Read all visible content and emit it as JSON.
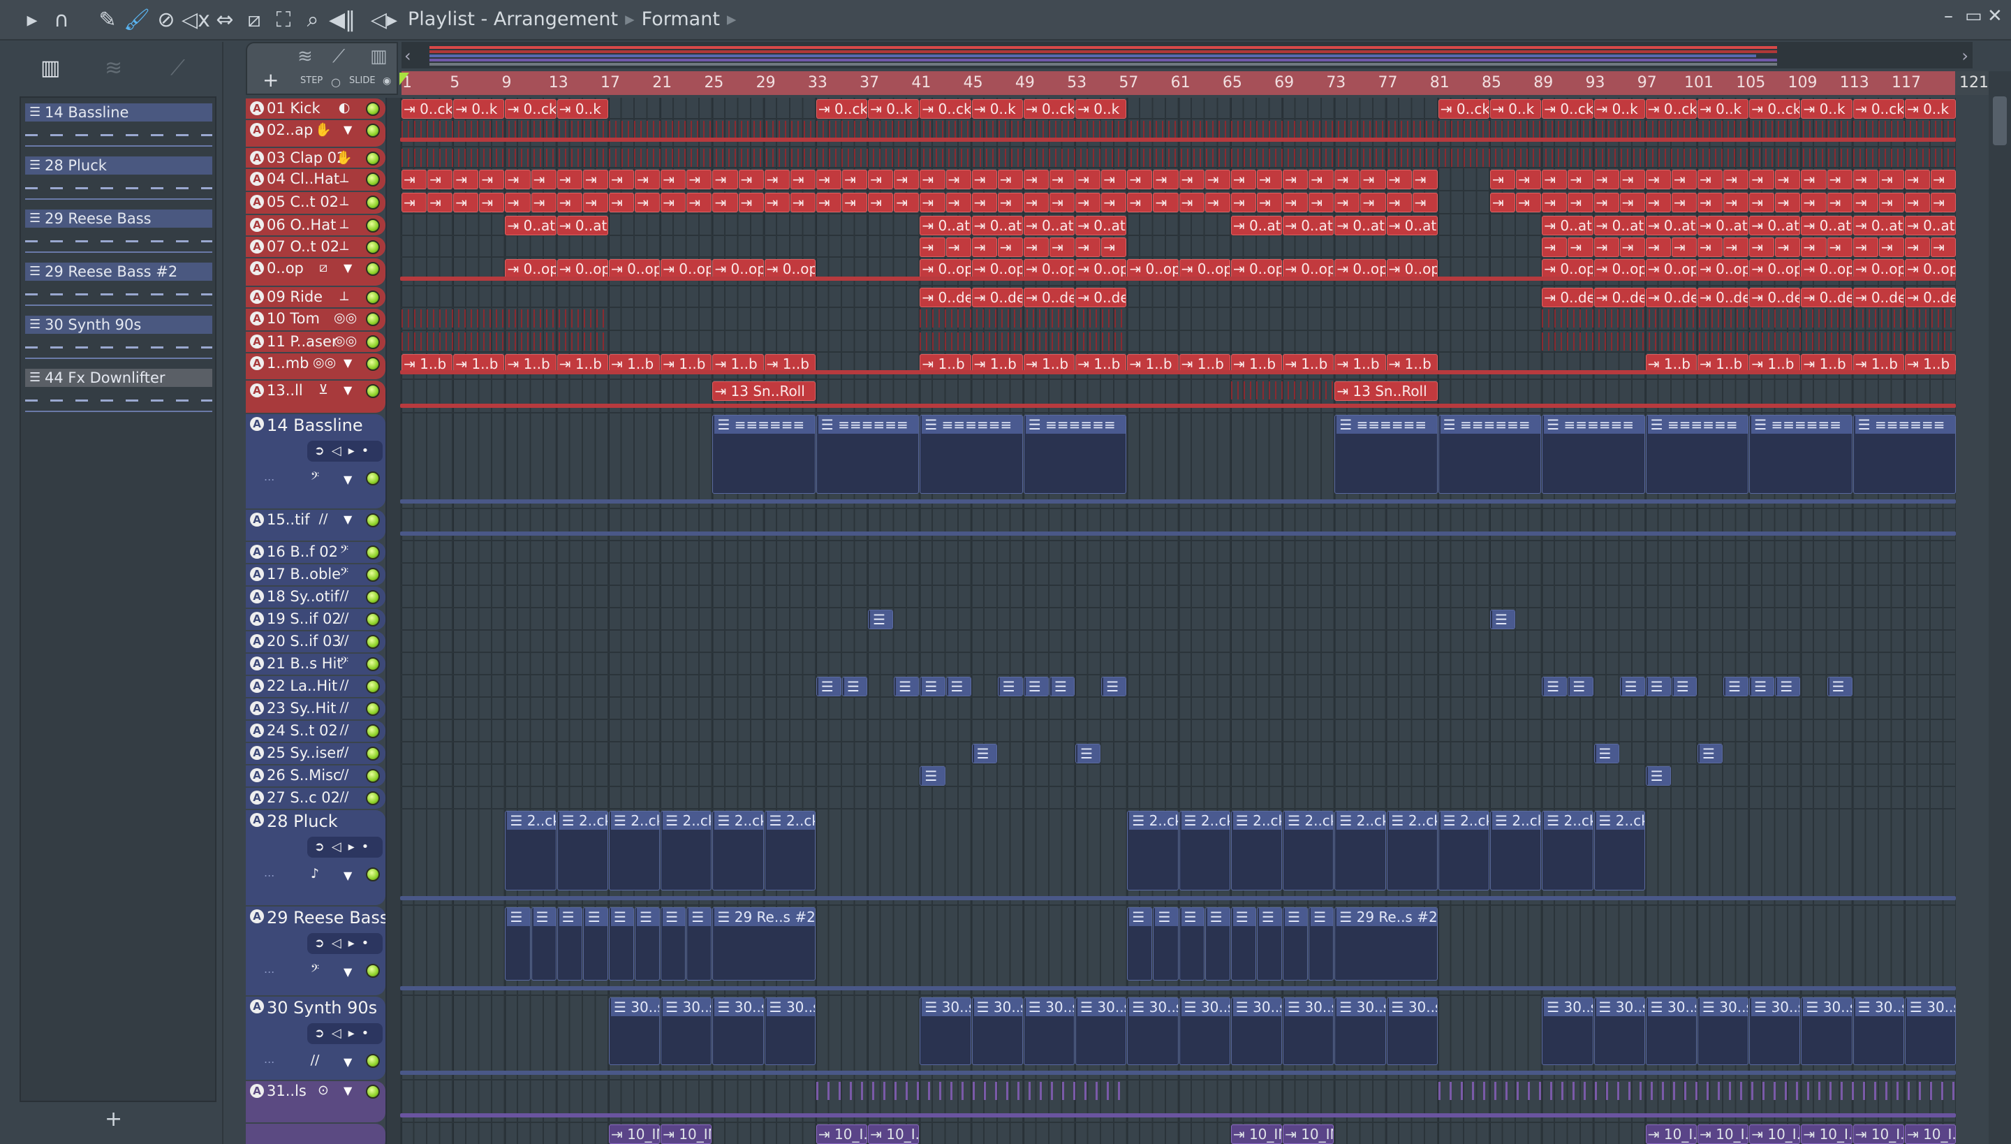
{
  "toolbar": {
    "icons": [
      "play-arrow",
      "magnet",
      "pencil",
      "brush",
      "mute",
      "mute-x",
      "slip",
      "slice",
      "select",
      "zoom",
      "playback"
    ],
    "title": "Playlist - Arrangement",
    "breadcrumb": "Formant"
  },
  "corner": {
    "step_label": "STEP",
    "slide_label": "SLIDE",
    "add": "+"
  },
  "picker": {
    "items": [
      {
        "label": "14 Bassline",
        "kind": "pattern"
      },
      {
        "label": "28 Pluck",
        "kind": "pattern"
      },
      {
        "label": "29 Reese Bass",
        "kind": "pattern"
      },
      {
        "label": "29 Reese Bass #2",
        "kind": "pattern"
      },
      {
        "label": "30 Synth 90s",
        "kind": "pattern"
      },
      {
        "label": "44 Fx Downlifter",
        "kind": "pattern"
      }
    ],
    "add": "+"
  },
  "ruler": {
    "bars": [
      1,
      5,
      9,
      13,
      17,
      21,
      25,
      29,
      33,
      37,
      41,
      45,
      49,
      53,
      57,
      61,
      65,
      69,
      73,
      77,
      81,
      85,
      89,
      93,
      97,
      101,
      105,
      109,
      113,
      117
    ],
    "end": "121"
  },
  "colors": {
    "red": "#a83a3c",
    "blue": "#3d4978",
    "purple": "#5b4a82",
    "clip_red": "#c23a3e",
    "led": "#8fd22a"
  },
  "tracks": [
    {
      "name": "01 Kick",
      "group": "red",
      "icon": "kick-drum",
      "runs": [
        [
          1,
          17,
          4,
          [
            "0..ck",
            "0..k"
          ]
        ],
        [
          33,
          41,
          4,
          [
            "0..ck",
            "0..k"
          ]
        ],
        [
          41,
          57,
          4,
          [
            "0..ck",
            "0..k"
          ]
        ],
        [
          81,
          121,
          4,
          [
            "0..ck",
            "0..k"
          ]
        ]
      ]
    },
    {
      "name": "02..ap",
      "group": "red",
      "icon": "clap",
      "drop": true,
      "ticks": [
        [
          1,
          121
        ]
      ]
    },
    {
      "name": "03 Clap 02",
      "group": "red",
      "icon": "clap",
      "ticks": [
        [
          1,
          121
        ]
      ]
    },
    {
      "name": "04 Cl..Hat",
      "group": "red",
      "icon": "hihat",
      "runs": [
        [
          1,
          33,
          2,
          [
            ""
          ]
        ],
        [
          33,
          41,
          2,
          [
            ""
          ]
        ],
        [
          41,
          81,
          2,
          [
            ""
          ]
        ],
        [
          85,
          89,
          2,
          [
            ""
          ]
        ],
        [
          89,
          121,
          2,
          [
            ""
          ]
        ]
      ]
    },
    {
      "name": "05 C..t 02",
      "group": "red",
      "icon": "hihat",
      "runs": [
        [
          1,
          33,
          2,
          [
            ""
          ]
        ],
        [
          33,
          41,
          2,
          [
            ""
          ]
        ],
        [
          41,
          81,
          2,
          [
            ""
          ]
        ],
        [
          85,
          89,
          2,
          [
            ""
          ]
        ],
        [
          89,
          121,
          2,
          [
            ""
          ]
        ]
      ]
    },
    {
      "name": "06 O..Hat",
      "group": "red",
      "icon": "hihat",
      "runs": [
        [
          9,
          17,
          4,
          [
            "0..at"
          ]
        ],
        [
          41,
          57,
          4,
          [
            "0..at"
          ]
        ],
        [
          65,
          81,
          4,
          [
            "0..at"
          ]
        ],
        [
          89,
          121,
          4,
          [
            "0..at"
          ]
        ]
      ]
    },
    {
      "name": "07 O..t 02",
      "group": "red",
      "icon": "hihat",
      "runs": [
        [
          41,
          57,
          2,
          [
            ""
          ]
        ],
        [
          89,
          121,
          2,
          [
            ""
          ]
        ]
      ]
    },
    {
      "name": "0..op",
      "group": "red",
      "icon": "sampler",
      "drop": true,
      "runs": [
        [
          9,
          33,
          4,
          [
            "0..op"
          ]
        ],
        [
          41,
          81,
          4,
          [
            "0..op"
          ]
        ],
        [
          89,
          121,
          4,
          [
            "0..op"
          ]
        ]
      ]
    },
    {
      "name": "09 Ride",
      "group": "red",
      "icon": "hihat",
      "runs": [
        [
          41,
          57,
          4,
          [
            "0..de"
          ]
        ],
        [
          89,
          121,
          4,
          [
            "0..de"
          ]
        ]
      ]
    },
    {
      "name": "10 Tom",
      "group": "red",
      "icon": "toms",
      "ticks": [
        [
          1,
          17
        ],
        [
          41,
          57
        ],
        [
          89,
          121
        ]
      ]
    },
    {
      "name": "11 P..aser",
      "group": "red",
      "icon": "toms",
      "ticks": [
        [
          1,
          17
        ],
        [
          41,
          57
        ],
        [
          89,
          121
        ]
      ]
    },
    {
      "name": "1..mb",
      "group": "red",
      "icon": "toms",
      "drop": true,
      "runs": [
        [
          1,
          33,
          4,
          [
            "1..b"
          ]
        ],
        [
          41,
          81,
          4,
          [
            "1..b"
          ]
        ],
        [
          97,
          121,
          4,
          [
            "1..b"
          ]
        ]
      ]
    },
    {
      "name": "13..ll",
      "group": "red",
      "icon": "snare",
      "drop": true,
      "runs": [
        [
          25,
          33,
          8,
          [
            "13 Sn..Roll"
          ]
        ],
        [
          73,
          81,
          8,
          [
            "13 Sn..Roll"
          ]
        ]
      ],
      "ticks": [
        [
          65,
          73
        ]
      ]
    },
    {
      "name": "14 Bassline",
      "group": "blue",
      "icon": "bass-clef",
      "drop": true,
      "tall": true,
      "runs": [
        [
          25,
          57,
          8,
          [
            "≡≡≡≡≡≡"
          ]
        ],
        [
          73,
          121,
          8,
          [
            "≡≡≡≡≡≡"
          ]
        ]
      ]
    },
    {
      "name": "15..tif",
      "group": "blue",
      "icon": "synth",
      "drop": true
    },
    {
      "name": "16 B..f 02",
      "group": "blue",
      "icon": "bass-clef"
    },
    {
      "name": "17 B..oble",
      "group": "blue",
      "icon": "bass-clef"
    },
    {
      "name": "18 Sy..otif",
      "group": "blue",
      "icon": "synth"
    },
    {
      "name": "19 S..if 02",
      "group": "blue",
      "icon": "synth",
      "runs": [
        [
          37,
          39,
          2,
          [
            ""
          ]
        ],
        [
          85,
          87,
          2,
          [
            ""
          ]
        ]
      ]
    },
    {
      "name": "20 S..if 03",
      "group": "blue",
      "icon": "synth"
    },
    {
      "name": "21 B..s Hit",
      "group": "blue",
      "icon": "bass-clef"
    },
    {
      "name": "22 La..Hit",
      "group": "blue",
      "icon": "synth",
      "runs": [
        [
          33,
          37,
          2,
          [
            ""
          ]
        ],
        [
          39,
          45,
          2,
          [
            ""
          ]
        ],
        [
          47,
          53,
          2,
          [
            ""
          ]
        ],
        [
          55,
          57,
          2,
          [
            ""
          ]
        ],
        [
          89,
          93,
          2,
          [
            ""
          ]
        ],
        [
          95,
          101,
          2,
          [
            ""
          ]
        ],
        [
          103,
          109,
          2,
          [
            ""
          ]
        ],
        [
          111,
          113,
          2,
          [
            ""
          ]
        ]
      ]
    },
    {
      "name": "23 Sy..Hit",
      "group": "blue",
      "icon": "synth"
    },
    {
      "name": "24 S..t 02",
      "group": "blue",
      "icon": "synth"
    },
    {
      "name": "25 Sy..iser",
      "group": "blue",
      "icon": "synth",
      "runs": [
        [
          45,
          47,
          2,
          [
            ""
          ]
        ],
        [
          53,
          55,
          2,
          [
            ""
          ]
        ],
        [
          93,
          95,
          2,
          [
            ""
          ]
        ],
        [
          101,
          103,
          2,
          [
            ""
          ]
        ]
      ]
    },
    {
      "name": "26 S..Misc",
      "group": "blue",
      "icon": "synth",
      "runs": [
        [
          41,
          43,
          2,
          [
            ""
          ]
        ],
        [
          97,
          99,
          2,
          [
            ""
          ]
        ]
      ]
    },
    {
      "name": "27 S..c 02",
      "group": "blue",
      "icon": "synth"
    },
    {
      "name": "28 Pluck",
      "group": "blue",
      "icon": "note",
      "drop": true,
      "tall": true,
      "runs": [
        [
          9,
          33,
          4,
          [
            "2..ck"
          ]
        ],
        [
          57,
          97,
          4,
          [
            "2..ck"
          ]
        ]
      ]
    },
    {
      "name": "29 Reese Bass",
      "group": "blue",
      "icon": "bass-clef",
      "drop": true,
      "tall": true,
      "runs": [
        [
          9,
          25,
          2,
          [
            ""
          ]
        ],
        [
          25,
          33,
          8,
          [
            "29 Re..s #2"
          ]
        ],
        [
          57,
          73,
          2,
          [
            ""
          ]
        ],
        [
          73,
          81,
          8,
          [
            "29 Re..s #2"
          ]
        ]
      ]
    },
    {
      "name": "30 Synth 90s",
      "group": "blue",
      "icon": "synth",
      "drop": true,
      "tall": true,
      "runs": [
        [
          17,
          33,
          4,
          [
            "30..s"
          ]
        ],
        [
          41,
          81,
          4,
          [
            "30..s"
          ]
        ],
        [
          89,
          121,
          4,
          [
            "30..s"
          ]
        ]
      ]
    },
    {
      "name": "31..ls",
      "group": "purple",
      "icon": "loop",
      "drop": true,
      "ticks": [
        [
          33,
          57
        ],
        [
          81,
          121
        ]
      ]
    },
    {
      "name": "",
      "group": "purple",
      "icon": "",
      "runs": [
        [
          17,
          25,
          4,
          [
            "10_IN..on 05"
          ]
        ],
        [
          33,
          41,
          4,
          [
            "10_I..n 05"
          ]
        ],
        [
          65,
          73,
          4,
          [
            "10_IN..on 05"
          ]
        ],
        [
          97,
          121,
          4,
          [
            "10_I..n 05"
          ]
        ]
      ]
    }
  ]
}
